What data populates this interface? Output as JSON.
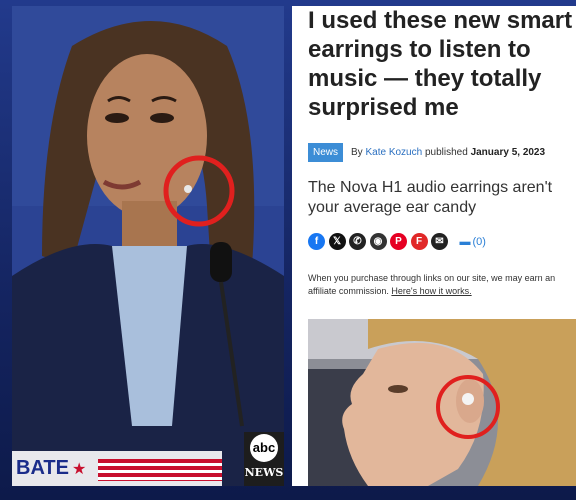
{
  "left_photo": {
    "banner_text": "BATE",
    "network_logo": "abc",
    "network_label": "NEWS"
  },
  "article": {
    "headline": "I used these new smart earrings to listen to music — they totally surprised me",
    "category_tag": "News",
    "by_prefix": "By",
    "author": "Kate Kozuch",
    "published_prefix": "published",
    "date": "January 5, 2023",
    "subheadline": "The Nova H1 audio earrings aren't your average ear candy",
    "share_icons": [
      {
        "name": "facebook",
        "glyph": "f",
        "color": "#1877f2"
      },
      {
        "name": "x",
        "glyph": "𝕏",
        "color": "#111111"
      },
      {
        "name": "whatsapp",
        "glyph": "✆",
        "color": "#222222"
      },
      {
        "name": "reddit",
        "glyph": "◉",
        "color": "#333333"
      },
      {
        "name": "pinterest",
        "glyph": "P",
        "color": "#e60023"
      },
      {
        "name": "flipboard",
        "glyph": "F",
        "color": "#e12828"
      },
      {
        "name": "email",
        "glyph": "✉",
        "color": "#222222"
      }
    ],
    "comment_count": "(0)",
    "disclaimer_text": "When you purchase through links on our site, we may earn an affiliate commission.",
    "disclaimer_link": "Here's how it works."
  },
  "colors": {
    "highlight_circle": "#e0201e",
    "news_tag": "#3c8dd6",
    "author_link": "#2a6fc0"
  }
}
